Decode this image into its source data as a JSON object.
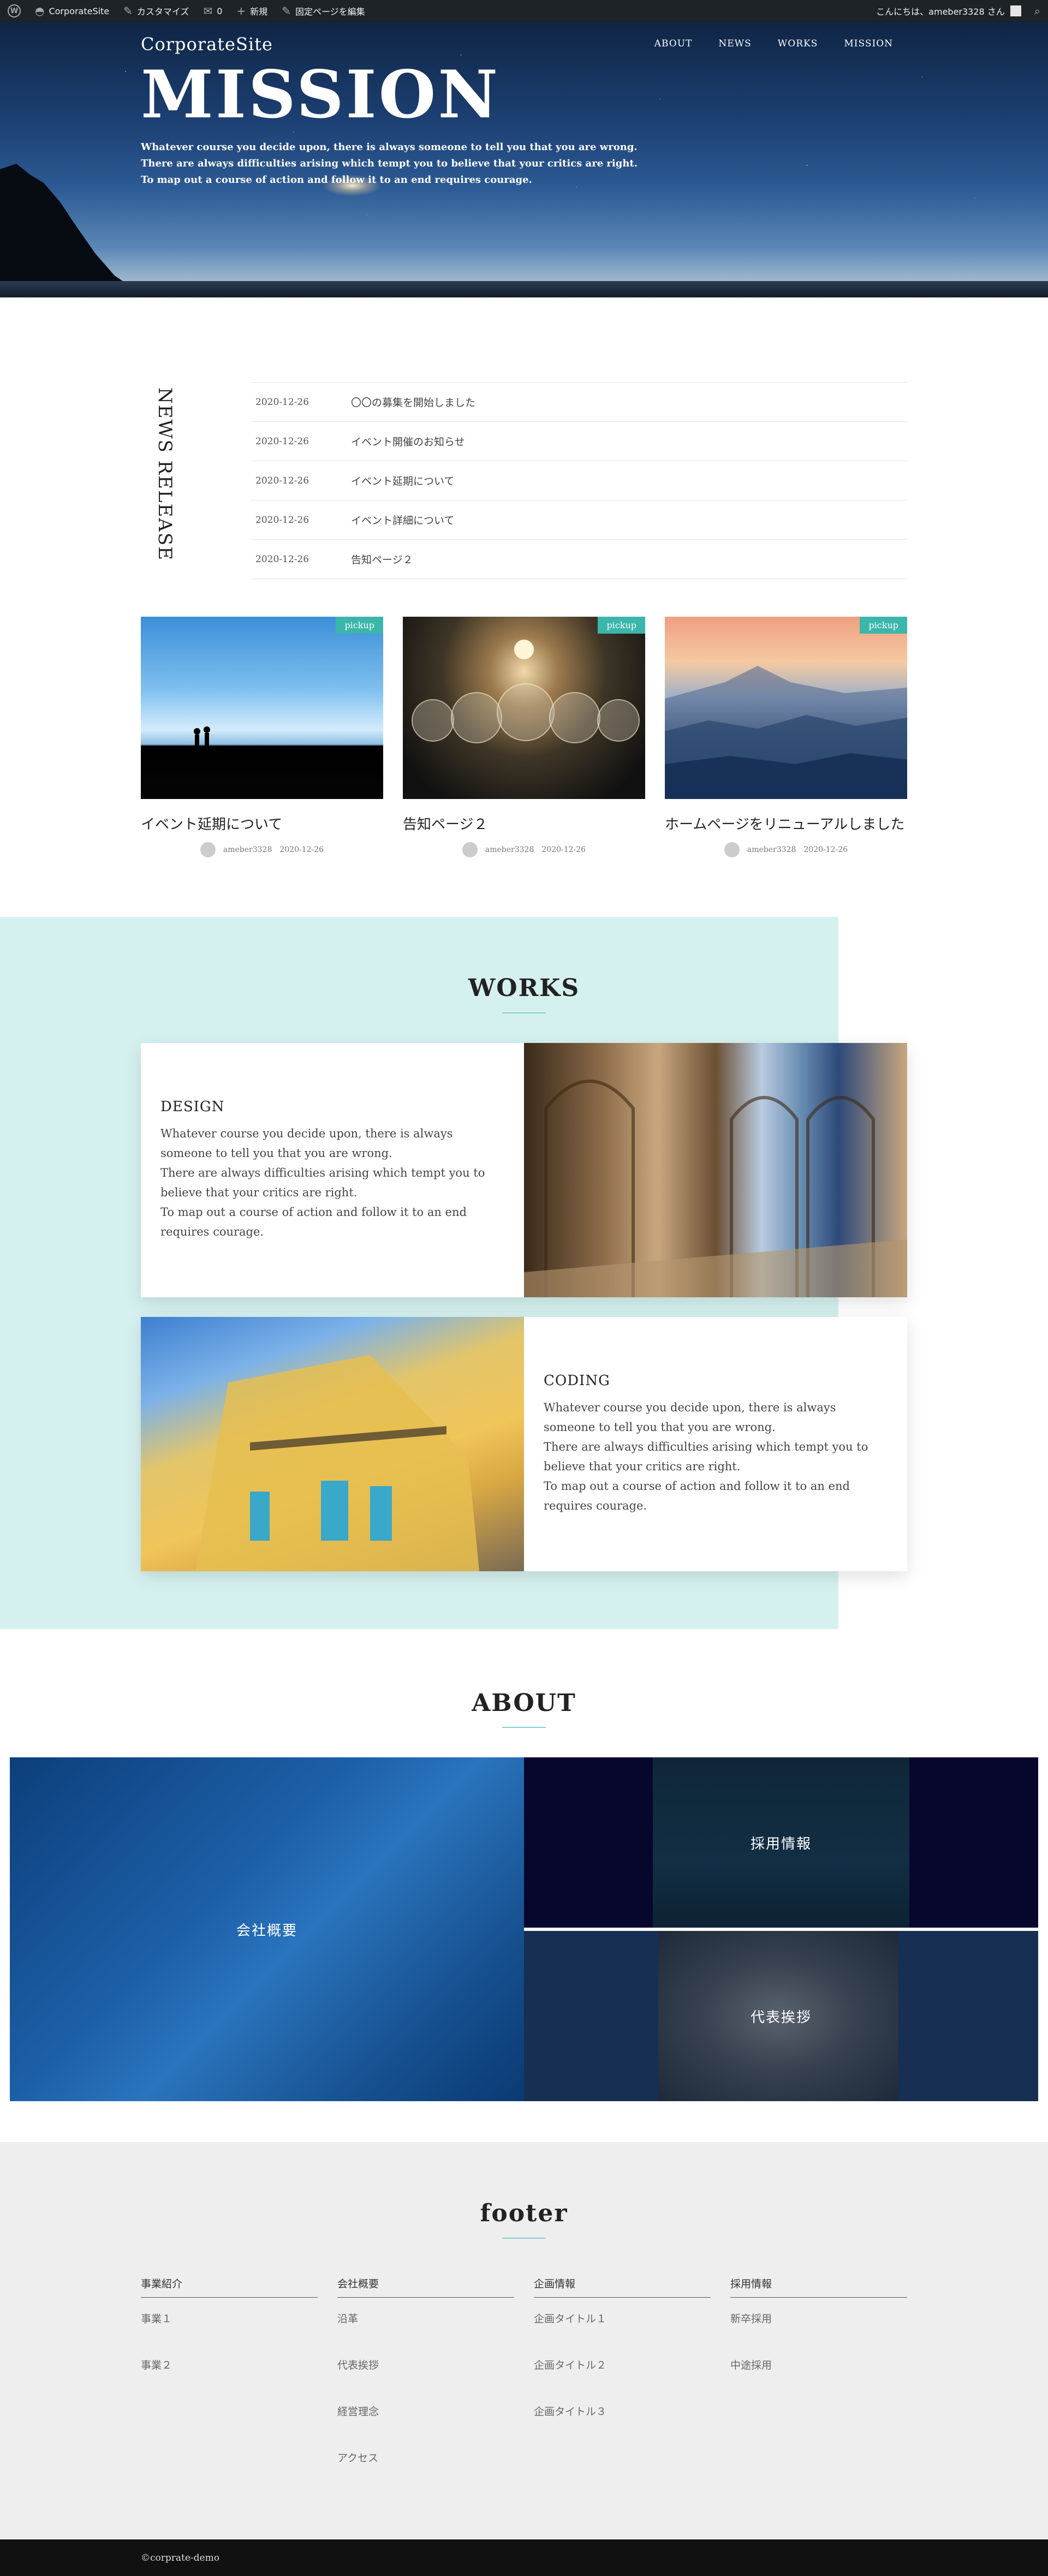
{
  "adminbar": {
    "site": "CorporateSite",
    "customize": "カスタマイズ",
    "comments": "0",
    "new": "新規",
    "edit": "固定ページを編集",
    "greeting": "こんにちは、ameber3328 さん"
  },
  "header": {
    "site_title": "CorporateSite",
    "nav": [
      "ABOUT",
      "NEWS",
      "WORKS",
      "MISSION"
    ]
  },
  "hero": {
    "title": "MISSION",
    "lead1": "Whatever course you decide upon, there is always someone to tell you that you are wrong.",
    "lead2": "There are always difficulties arising which tempt you to believe that your critics are right.",
    "lead3": "To map out a course of action and follow it to an end requires courage."
  },
  "news": {
    "heading": "NEWS RELEASE",
    "items": [
      {
        "date": "2020-12-26",
        "title": "〇〇の募集を開始しました"
      },
      {
        "date": "2020-12-26",
        "title": "イベント開催のお知らせ"
      },
      {
        "date": "2020-12-26",
        "title": "イベント延期について"
      },
      {
        "date": "2020-12-26",
        "title": "イベント詳細について"
      },
      {
        "date": "2020-12-26",
        "title": "告知ページ２"
      }
    ]
  },
  "cards": [
    {
      "badge": "pickup",
      "title": "イベント延期について",
      "author": "ameber3328",
      "date": "2020-12-26"
    },
    {
      "badge": "pickup",
      "title": "告知ページ２",
      "author": "ameber3328",
      "date": "2020-12-26"
    },
    {
      "badge": "pickup",
      "title": "ホームページをリニューアルしました",
      "author": "ameber3328",
      "date": "2020-12-26"
    }
  ],
  "works": {
    "title": "WORKS",
    "items": [
      {
        "heading": "DESIGN",
        "line1": "Whatever course you decide upon, there is always",
        "line2": "someone to tell you that you are wrong.",
        "line3": "There are always difficulties arising which tempt you to",
        "line4": "believe that your critics are right.",
        "line5": "To map out a course of action and follow it to an end",
        "line6": "requires courage."
      },
      {
        "heading": "CODING",
        "line1": "Whatever course you decide upon, there is always",
        "line2": "someone to tell you that you are wrong.",
        "line3": "There are always difficulties arising which tempt you to",
        "line4": "believe that your critics are right.",
        "line5": "To map out a course of action and follow it to an end",
        "line6": "requires courage."
      }
    ]
  },
  "about": {
    "title": "ABOUT",
    "company": "会社概要",
    "recruit": "採用情報",
    "greeting": "代表挨拶"
  },
  "footer": {
    "title": "footer",
    "columns": [
      {
        "heading": "事業紹介",
        "links": [
          "事業１",
          "事業２"
        ]
      },
      {
        "heading": "会社概要",
        "links": [
          "沿革",
          "代表挨拶",
          "経営理念",
          "アクセス"
        ]
      },
      {
        "heading": "企画情報",
        "links": [
          "企画タイトル１",
          "企画タイトル２",
          "企画タイトル３"
        ]
      },
      {
        "heading": "採用情報",
        "links": [
          "新卒採用",
          "中途採用"
        ]
      }
    ],
    "copyright": "©corprate-demo"
  },
  "colors": {
    "accent": "#3bb6ab",
    "works_bg": "#d5f1ef",
    "adminbar": "#1d2327",
    "footer_bg": "#eeeeee",
    "copy_bg": "#111111"
  }
}
